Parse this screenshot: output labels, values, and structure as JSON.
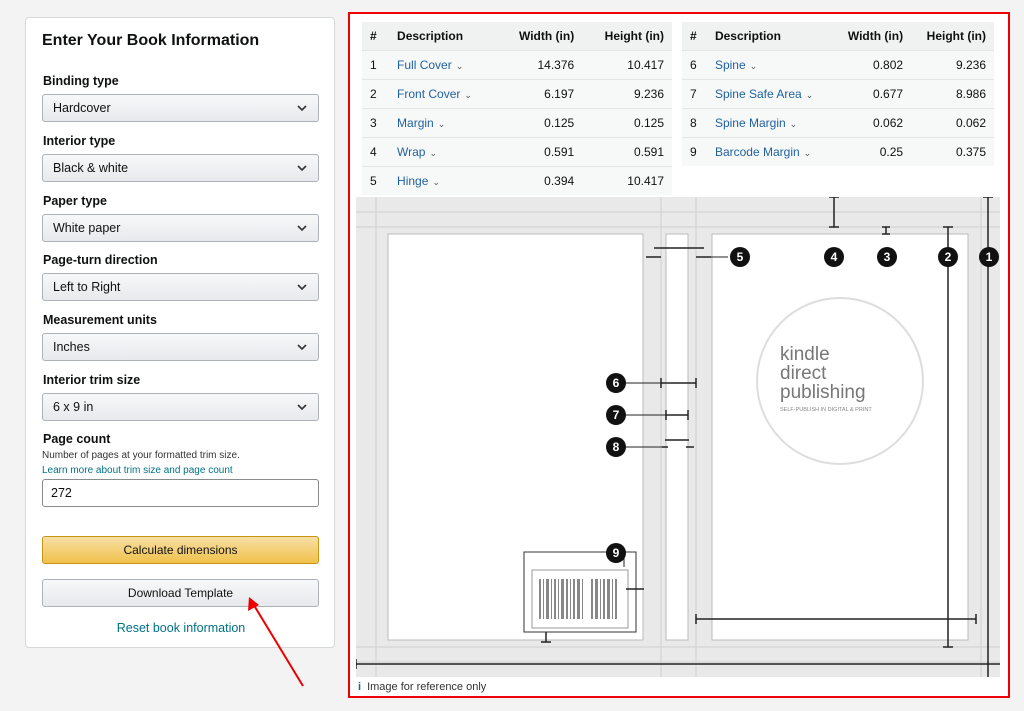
{
  "form": {
    "title": "Enter Your Book Information",
    "binding_label": "Binding type",
    "binding_value": "Hardcover",
    "interior_label": "Interior type",
    "interior_value": "Black & white",
    "paper_label": "Paper type",
    "paper_value": "White paper",
    "direction_label": "Page-turn direction",
    "direction_value": "Left to Right",
    "units_label": "Measurement units",
    "units_value": "Inches",
    "trim_label": "Interior trim size",
    "trim_value": "6 x 9 in",
    "pagecount_label": "Page count",
    "pagecount_help": "Number of pages at your formatted trim size.",
    "pagecount_link": "Learn more about trim size and page count",
    "pagecount_value": "272",
    "calculate_label": "Calculate dimensions",
    "download_label": "Download Template",
    "reset_label": "Reset book information"
  },
  "table": {
    "headers": [
      "#",
      "Description",
      "Width (in)",
      "Height (in)"
    ],
    "left": [
      {
        "n": "1",
        "d": "Full Cover",
        "w": "14.376",
        "h": "10.417"
      },
      {
        "n": "2",
        "d": "Front Cover",
        "w": "6.197",
        "h": "9.236"
      },
      {
        "n": "3",
        "d": "Margin",
        "w": "0.125",
        "h": "0.125"
      },
      {
        "n": "4",
        "d": "Wrap",
        "w": "0.591",
        "h": "0.591"
      },
      {
        "n": "5",
        "d": "Hinge",
        "w": "0.394",
        "h": "10.417"
      }
    ],
    "right": [
      {
        "n": "6",
        "d": "Spine",
        "w": "0.802",
        "h": "9.236"
      },
      {
        "n": "7",
        "d": "Spine Safe Area",
        "w": "0.677",
        "h": "8.986"
      },
      {
        "n": "8",
        "d": "Spine Margin",
        "w": "0.062",
        "h": "0.062"
      },
      {
        "n": "9",
        "d": "Barcode Margin",
        "w": "0.25",
        "h": "0.375"
      }
    ]
  },
  "diagram": {
    "logo_line1": "kindle",
    "logo_line2": "direct",
    "logo_line3": "publishing",
    "logo_tagline": "SELF-PUBLISH IN DIGITAL & PRINT",
    "markers": [
      "1",
      "2",
      "3",
      "4",
      "5",
      "6",
      "7",
      "8",
      "9"
    ]
  },
  "footnote": {
    "icon": "i",
    "text": "Image for reference only"
  },
  "colors": {
    "accent_red": "#e00000",
    "link": "#2162a1",
    "button_yellow": "#f0c14b"
  }
}
